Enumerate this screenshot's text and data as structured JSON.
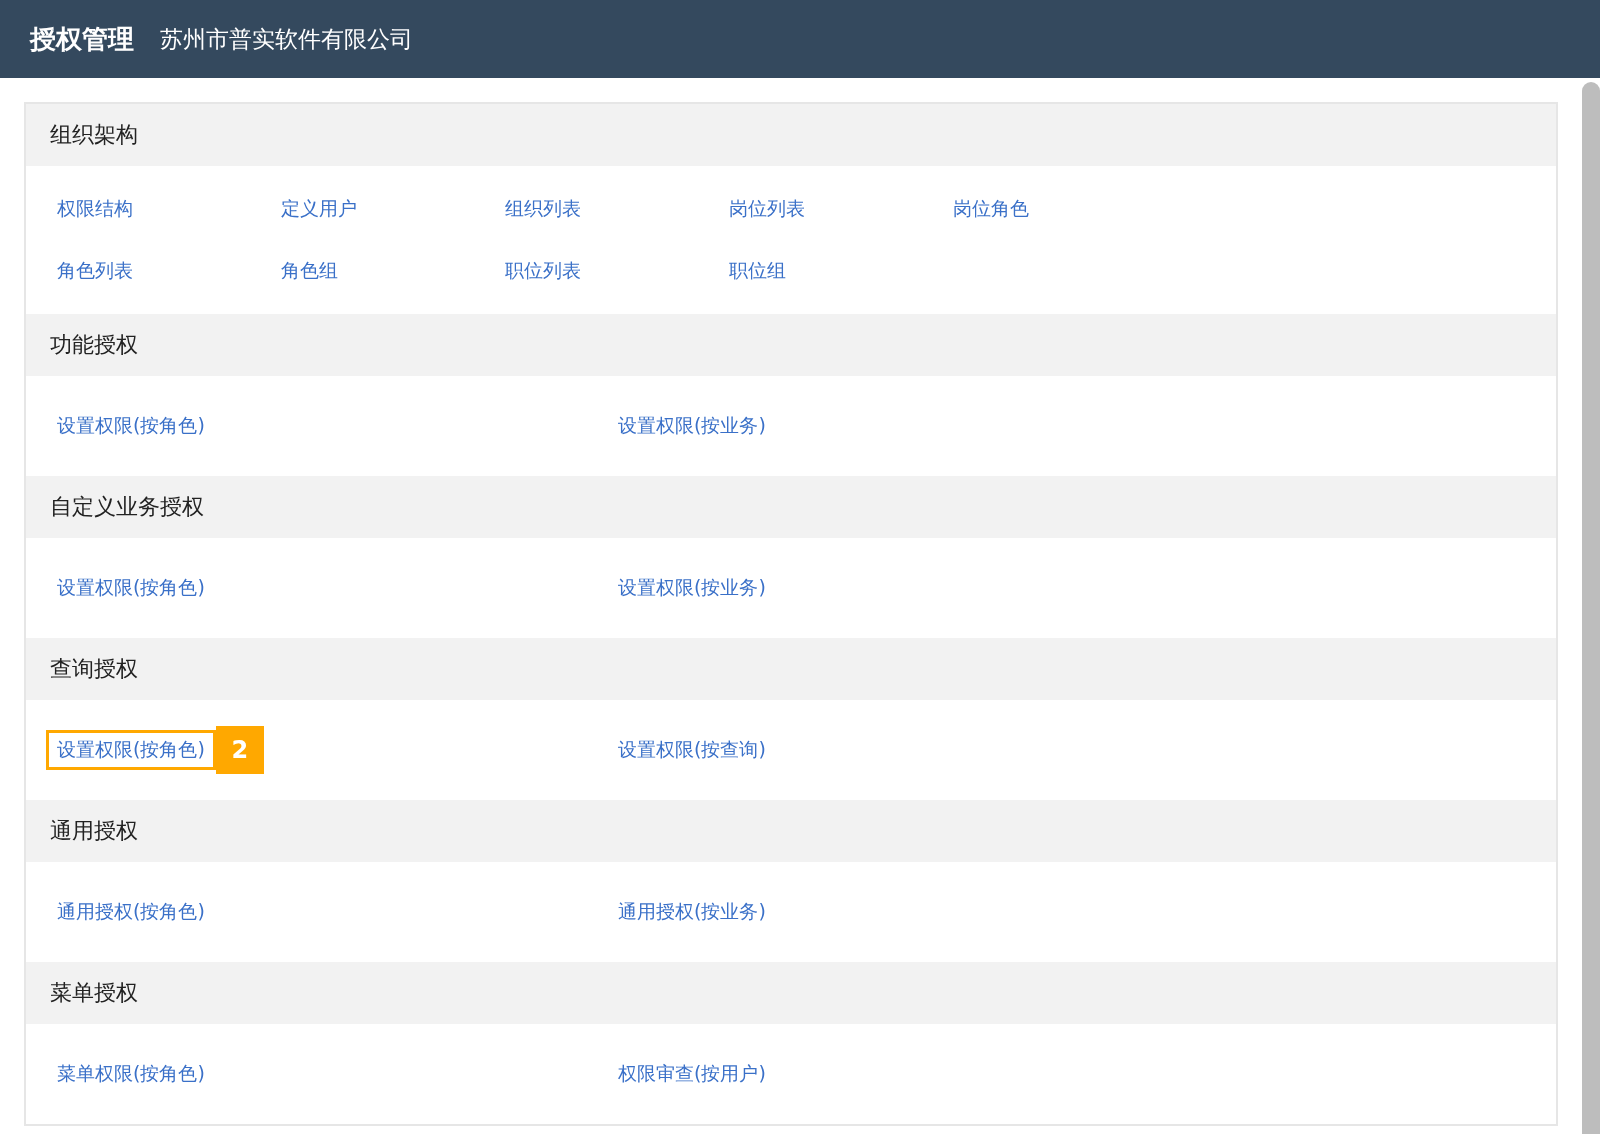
{
  "header": {
    "title": "授权管理",
    "company": "苏州市普实软件有限公司"
  },
  "sections": [
    {
      "title": "组织架构",
      "kind": "grid",
      "links": [
        {
          "label": "权限结构"
        },
        {
          "label": "定义用户"
        },
        {
          "label": "组织列表"
        },
        {
          "label": "岗位列表"
        },
        {
          "label": "岗位角色"
        },
        {
          "label": "角色列表"
        },
        {
          "label": "角色组"
        },
        {
          "label": "职位列表"
        },
        {
          "label": "职位组"
        }
      ]
    },
    {
      "title": "功能授权",
      "kind": "pair",
      "links": [
        {
          "label": "设置权限(按角色)"
        },
        {
          "label": "设置权限(按业务)"
        }
      ]
    },
    {
      "title": "自定义业务授权",
      "kind": "pair",
      "links": [
        {
          "label": "设置权限(按角色)"
        },
        {
          "label": "设置权限(按业务)"
        }
      ]
    },
    {
      "title": "查询授权",
      "kind": "pair",
      "links": [
        {
          "label": "设置权限(按角色)",
          "callout": "2"
        },
        {
          "label": "设置权限(按查询)"
        }
      ]
    },
    {
      "title": "通用授权",
      "kind": "pair",
      "links": [
        {
          "label": "通用授权(按角色)"
        },
        {
          "label": "通用授权(按业务)"
        }
      ]
    },
    {
      "title": "菜单授权",
      "kind": "pair",
      "links": [
        {
          "label": "菜单权限(按角色)"
        },
        {
          "label": "权限审查(按用户)"
        }
      ]
    }
  ]
}
